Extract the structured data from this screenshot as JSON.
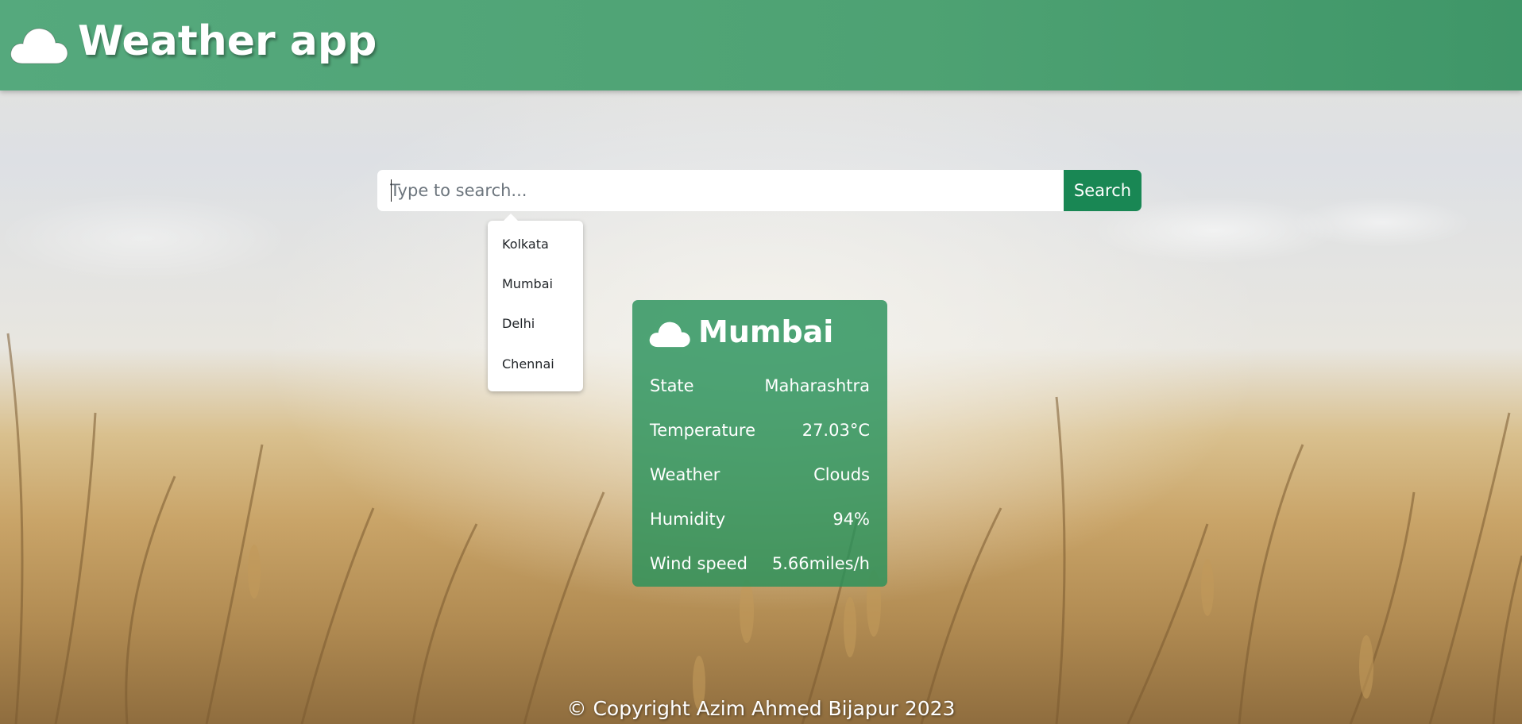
{
  "header": {
    "icon": "cloud-icon",
    "title": "Weather app"
  },
  "search": {
    "placeholder": "Type to search...",
    "value": "",
    "button_label": "Search"
  },
  "suggestions": [
    "Kolkata",
    "Mumbai",
    "Delhi",
    "Chennai"
  ],
  "weather_card": {
    "icon": "cloud-icon",
    "city": "Mumbai",
    "rows": [
      {
        "label": "State",
        "value": "Maharashtra"
      },
      {
        "label": "Temperature",
        "value": "27.03°C"
      },
      {
        "label": "Weather",
        "value": "Clouds"
      },
      {
        "label": "Humidity",
        "value": "94%"
      },
      {
        "label": "Wind speed",
        "value": "5.66miles/h"
      }
    ]
  },
  "footer": {
    "text": "© Copyright Azim Ahmed Bijapur 2023"
  },
  "colors": {
    "header": "#4ea273",
    "search_button": "#198754",
    "card": "#28915a"
  }
}
